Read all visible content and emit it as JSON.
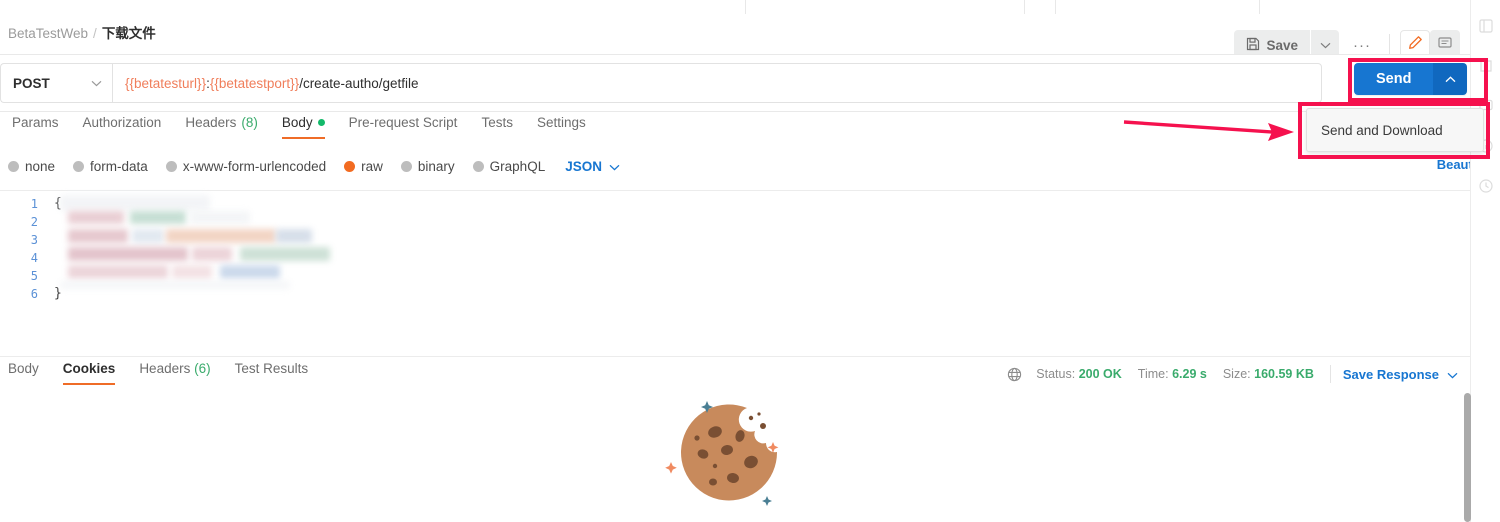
{
  "breadcrumb": {
    "parent": "BetaTestWeb",
    "separator": "/",
    "current": "下载文件"
  },
  "toolbar": {
    "save_label": "Save",
    "save_icon": "floppy-disk-icon",
    "save_caret_icon": "chevron-down-icon",
    "more_label": "···",
    "edit_icon": "pencil-icon",
    "comment_icon": "comment-icon"
  },
  "request": {
    "method": "POST",
    "method_caret_icon": "chevron-down-icon",
    "url_parts": [
      {
        "text": "{{betatesturl}}",
        "kind": "var"
      },
      {
        "text": ":",
        "kind": "plain"
      },
      {
        "text": "{{betatestport}}",
        "kind": "var"
      },
      {
        "text": "/create-autho/getfile",
        "kind": "plain"
      }
    ],
    "url_full": "{{betatesturl}}:{{betatestport}}/create-autho/getfile",
    "send_label": "Send",
    "send_caret_icon": "chevron-up-icon",
    "send_dropdown_item": "Send and Download"
  },
  "request_tabs": [
    {
      "label": "Params",
      "active": false
    },
    {
      "label": "Authorization",
      "active": false
    },
    {
      "label": "Headers",
      "count": "(8)",
      "active": false
    },
    {
      "label": "Body",
      "active": true,
      "dot": true
    },
    {
      "label": "Pre-request Script",
      "active": false
    },
    {
      "label": "Tests",
      "active": false
    },
    {
      "label": "Settings",
      "active": false
    }
  ],
  "body_types": [
    {
      "label": "none",
      "selected": false
    },
    {
      "label": "form-data",
      "selected": false
    },
    {
      "label": "x-www-form-urlencoded",
      "selected": false
    },
    {
      "label": "raw",
      "selected": true
    },
    {
      "label": "binary",
      "selected": false
    },
    {
      "label": "GraphQL",
      "selected": false
    }
  ],
  "body_format": {
    "label": "JSON",
    "caret_icon": "chevron-down-icon"
  },
  "beautify_label": "Beautify",
  "editor": {
    "line_numbers": [
      "1",
      "2",
      "3",
      "4",
      "5",
      "6"
    ],
    "open_brace": "{",
    "close_brace": "}",
    "content_note": "blurred"
  },
  "response_tabs": [
    {
      "label": "Body",
      "active": false
    },
    {
      "label": "Cookies",
      "active": true
    },
    {
      "label": "Headers",
      "count": "(6)",
      "active": false
    },
    {
      "label": "Test Results",
      "active": false
    }
  ],
  "response_meta": {
    "globe_icon": "globe-icon",
    "status_label": "Status:",
    "status_value": "200 OK",
    "time_label": "Time:",
    "time_value": "6.29 s",
    "size_label": "Size:",
    "size_value": "160.59 KB",
    "save_response_label": "Save Response",
    "save_response_caret_icon": "chevron-down-icon"
  },
  "cookie_illustration": "cookie-icon",
  "colors": {
    "accent_orange": "#ef6c27",
    "link_blue": "#1776d1",
    "send_blue": "#1776d1",
    "green": "#3aab6c",
    "annotation_red": "#f5114e",
    "variable_orange": "#f07e5b",
    "cookie_body": "#c88a5c",
    "cookie_chip": "#7a4f33"
  }
}
